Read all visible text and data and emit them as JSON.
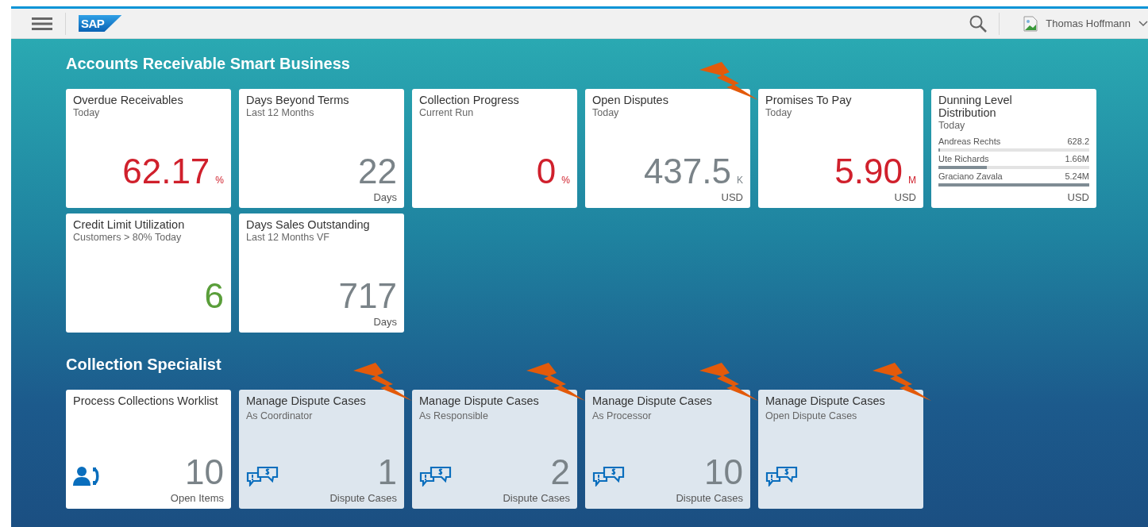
{
  "header": {
    "logo": "SAP",
    "user": "Thomas Hoffmann"
  },
  "groups": [
    {
      "title": "Accounts Receivable Smart Business",
      "tiles": [
        {
          "kind": "kpi",
          "title": "Overdue Receivables",
          "subtitle": "Today",
          "number": "62.17",
          "scale": "%",
          "color": "#d0202c",
          "flagged": false
        },
        {
          "kind": "kpi",
          "title": "Days Beyond Terms",
          "subtitle": "Last 12 Months",
          "number": "22",
          "color": "#7a8388",
          "footer": "Days",
          "flagged": false
        },
        {
          "kind": "kpi",
          "title": "Collection Progress",
          "subtitle": "Current Run",
          "number": "0",
          "scale": "%",
          "color": "#d0202c",
          "flagged": false
        },
        {
          "kind": "kpi",
          "title": "Open Disputes",
          "subtitle": "Today",
          "number": "437.5",
          "scale": "K",
          "color": "#7a8388",
          "footer": "USD",
          "flagged": true
        },
        {
          "kind": "kpi",
          "title": "Promises To Pay",
          "subtitle": "Today",
          "number": "5.90",
          "scale": "M",
          "color": "#d0202c",
          "footer": "USD",
          "flagged": false
        },
        {
          "kind": "comparison",
          "title": "Dunning Level Distribution",
          "subtitle": "Today",
          "footer": "USD",
          "flagged": false,
          "items": [
            {
              "name": "Andreas Rechts",
              "value": "628.2",
              "level": 0.01
            },
            {
              "name": "Ute Richards",
              "value": "1.66M",
              "level": 0.32
            },
            {
              "name": "Graciano Zavala",
              "value": "5.24M",
              "level": 1.0
            }
          ]
        },
        {
          "kind": "kpi",
          "title": "Credit Limit Utilization",
          "subtitle": "Customers > 80% Today",
          "number": "6",
          "color": "#5a9e3a",
          "flagged": false
        },
        {
          "kind": "kpi",
          "title": "Days Sales Outstanding",
          "subtitle": "Last 12 Months VF",
          "number": "717",
          "color": "#7a8388",
          "footer": "Days",
          "flagged": false
        }
      ]
    },
    {
      "title": "Collection Specialist",
      "tiles": [
        {
          "kind": "worklist",
          "title": "Process Collections Worklist",
          "number": "10",
          "footer": "Open Items",
          "flagged": false
        },
        {
          "kind": "dispute",
          "title": "Manage Dispute Cases",
          "subtitle": "As Coordinator",
          "number": "1",
          "footer": "Dispute Cases",
          "flagged": true
        },
        {
          "kind": "dispute",
          "title": "Manage Dispute Cases",
          "subtitle": "As Responsible",
          "number": "2",
          "footer": "Dispute Cases",
          "flagged": true
        },
        {
          "kind": "dispute",
          "title": "Manage Dispute Cases",
          "subtitle": "As Processor",
          "number": "10",
          "footer": "Dispute Cases",
          "flagged": true
        },
        {
          "kind": "dispute",
          "title": "Manage Dispute Cases",
          "subtitle": "Open Dispute Cases",
          "flagged": true
        }
      ]
    }
  ]
}
